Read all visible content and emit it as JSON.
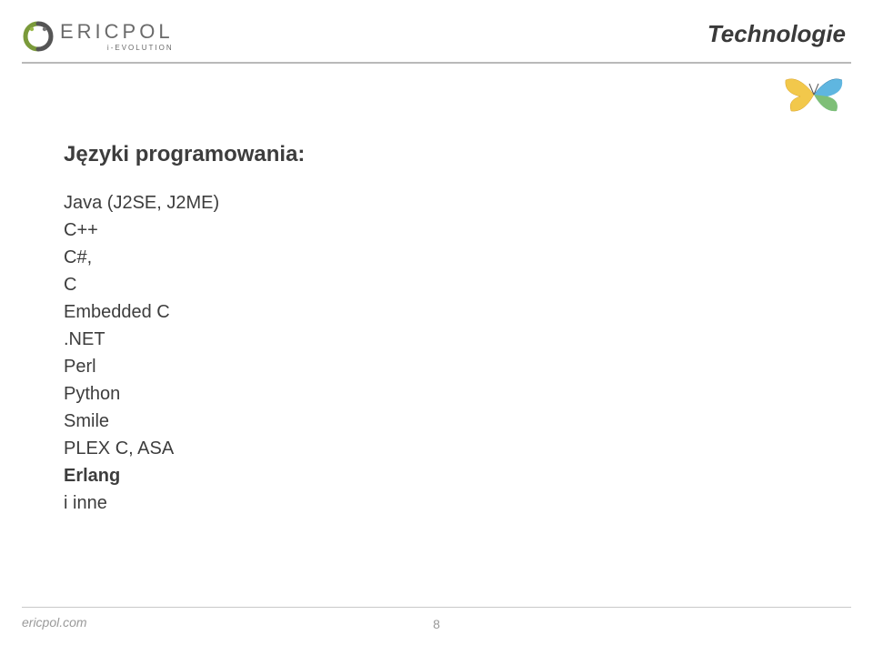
{
  "header": {
    "logo_text": "ERICPOL",
    "logo_sub": "i-EVOLUTION",
    "title": "Technologie"
  },
  "content": {
    "heading": "Języki programowania:",
    "items": [
      {
        "text": "Java (J2SE, J2ME)",
        "bold": false
      },
      {
        "text": "C++",
        "bold": false
      },
      {
        "text": "C#,",
        "bold": false
      },
      {
        "text": "C",
        "bold": false
      },
      {
        "text": "Embedded C",
        "bold": false
      },
      {
        "text": ".NET",
        "bold": false
      },
      {
        "text": "Perl",
        "bold": false
      },
      {
        "text": "Python",
        "bold": false
      },
      {
        "text": "Smile",
        "bold": false
      },
      {
        "text": "PLEX C, ASA",
        "bold": false
      },
      {
        "text": "Erlang",
        "bold": true
      },
      {
        "text": "i inne",
        "bold": false
      }
    ]
  },
  "footer": {
    "site": "ericpol.com",
    "page": "8"
  }
}
